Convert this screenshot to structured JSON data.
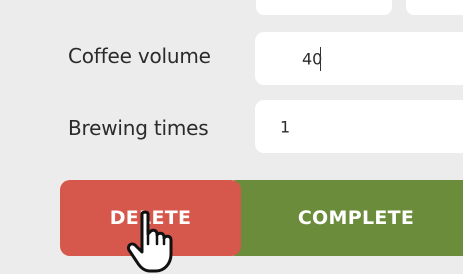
{
  "form": {
    "coffee_volume": {
      "label": "Coffee volume",
      "value": "40"
    },
    "brewing_times": {
      "label": "Brewing times",
      "value": "1"
    }
  },
  "actions": {
    "delete_label": "DELETE",
    "complete_label": "COMPLETE"
  },
  "colors": {
    "background": "#ececec",
    "delete": "#d6574c",
    "complete": "#6b8c3b"
  },
  "cursor_icon": "hand-pointer-icon"
}
